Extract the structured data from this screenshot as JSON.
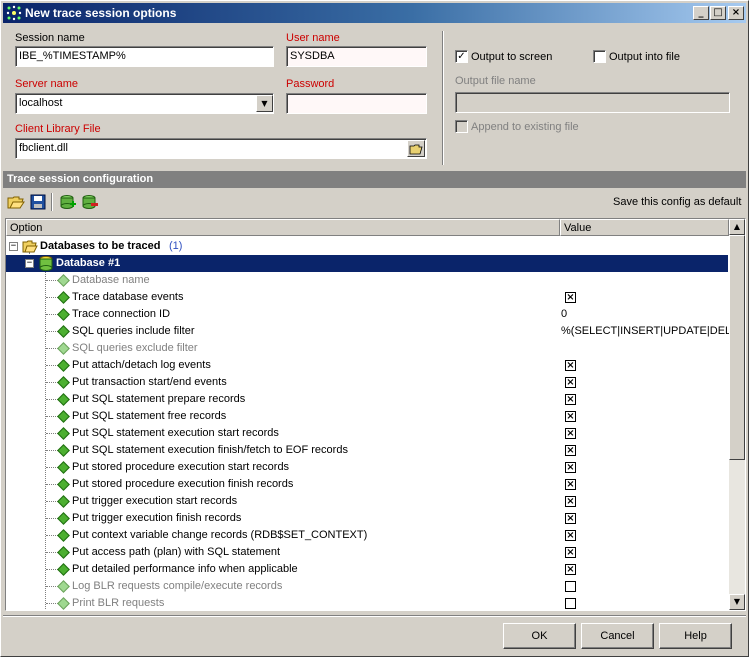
{
  "window": {
    "title": "New trace session options"
  },
  "session": {
    "session_name_label": "Session name",
    "session_name_value": "IBE_%TIMESTAMP%",
    "user_name_label": "User name",
    "user_name_value": "SYSDBA",
    "server_name_label": "Server name",
    "server_name_value": "localhost",
    "password_label": "Password",
    "password_value": "",
    "client_library_label": "Client Library File",
    "client_library_value": "fbclient.dll"
  },
  "output": {
    "to_screen_label": "Output to screen",
    "to_screen_checked": true,
    "into_file_label": "Output into file",
    "into_file_checked": false,
    "file_name_label": "Output file name",
    "file_name_value": "",
    "append_label": "Append to existing file"
  },
  "config": {
    "section_title": "Trace session configuration",
    "save_default_label": "Save this config as default",
    "col_option": "Option",
    "col_value": "Value",
    "databases_label": "Databases to be traced",
    "databases_count": "(1)",
    "database_label": "Database #1",
    "items": [
      {
        "label": "Database name",
        "value": "",
        "kind": "text",
        "disabled": true
      },
      {
        "label": "Trace database events",
        "value": "checked",
        "kind": "check",
        "disabled": false
      },
      {
        "label": "Trace connection ID",
        "value": "0",
        "kind": "text",
        "disabled": false
      },
      {
        "label": "SQL queries include filter",
        "value": "%(SELECT|INSERT|UPDATE|DELE...",
        "kind": "text",
        "disabled": false
      },
      {
        "label": "SQL queries exclude filter",
        "value": "",
        "kind": "text",
        "disabled": true
      },
      {
        "label": "Put attach/detach log events",
        "value": "checked",
        "kind": "check",
        "disabled": false
      },
      {
        "label": "Put transaction start/end events",
        "value": "checked",
        "kind": "check",
        "disabled": false
      },
      {
        "label": "Put SQL statement prepare records",
        "value": "checked",
        "kind": "check",
        "disabled": false
      },
      {
        "label": "Put SQL statement free records",
        "value": "checked",
        "kind": "check",
        "disabled": false
      },
      {
        "label": "Put SQL statement execution start records",
        "value": "checked",
        "kind": "check",
        "disabled": false
      },
      {
        "label": "Put SQL statement execution finish/fetch to EOF records",
        "value": "checked",
        "kind": "check",
        "disabled": false
      },
      {
        "label": "Put stored procedure execution start records",
        "value": "checked",
        "kind": "check",
        "disabled": false
      },
      {
        "label": "Put stored procedure execution finish records",
        "value": "checked",
        "kind": "check",
        "disabled": false
      },
      {
        "label": "Put trigger execution start records",
        "value": "checked",
        "kind": "check",
        "disabled": false
      },
      {
        "label": "Put trigger execution finish records",
        "value": "checked",
        "kind": "check",
        "disabled": false
      },
      {
        "label": "Put context variable change records (RDB$SET_CONTEXT)",
        "value": "checked",
        "kind": "check",
        "disabled": false
      },
      {
        "label": "Put access path (plan) with SQL statement",
        "value": "checked",
        "kind": "check",
        "disabled": false
      },
      {
        "label": "Put detailed performance info when applicable",
        "value": "checked",
        "kind": "check",
        "disabled": false
      },
      {
        "label": "Log BLR requests compile/execute records",
        "value": "unchecked",
        "kind": "check",
        "disabled": true
      },
      {
        "label": "Print BLR requests",
        "value": "unchecked",
        "kind": "check",
        "disabled": true
      }
    ]
  },
  "buttons": {
    "ok": "OK",
    "cancel": "Cancel",
    "help": "Help"
  },
  "icons": {
    "title": "trace-icon",
    "open": "folder-open-icon",
    "save": "save-icon",
    "add_db": "add-database-icon",
    "remove_db": "remove-database-icon",
    "file_picker": "open-file-icon"
  }
}
